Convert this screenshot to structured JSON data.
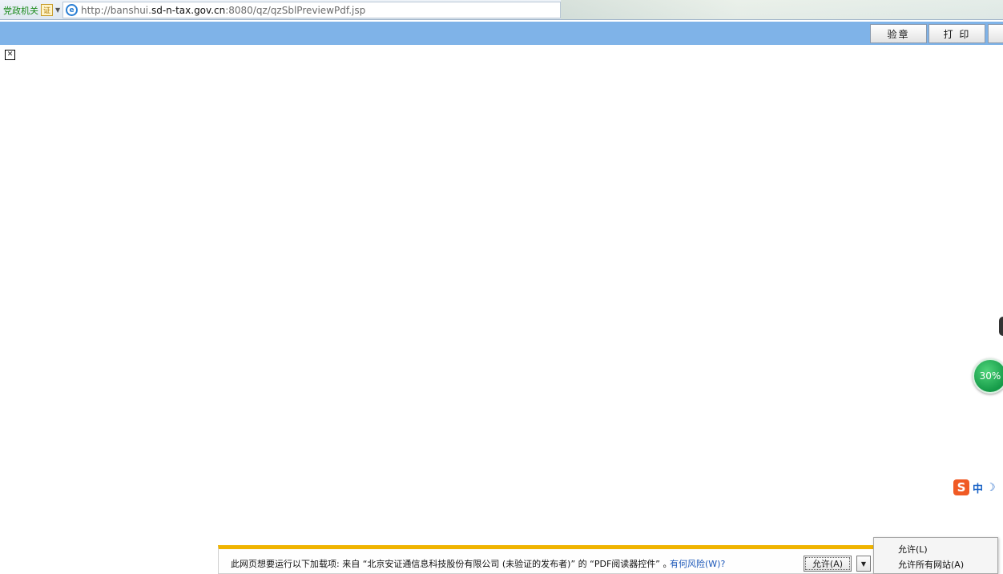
{
  "address_bar": {
    "zone_label": "党政机关",
    "cert_label": "证",
    "url_scheme": "http://banshui.",
    "url_host": "sd-n-tax.gov.cn",
    "url_path": ":8080/qz/qzSblPreviewPdf.jsp"
  },
  "toolbar": {
    "seal_label": "验章",
    "print_label": "打 印"
  },
  "content": {
    "close_glyph": "✕",
    "progress_label": "30%",
    "ime_logo": "S",
    "ime_lang": "中",
    "ime_moon": "☽"
  },
  "notification": {
    "message": "此网页想要运行以下加载项: 来自 “北京安证通信息科技股份有限公司 (未验证的发布者)” 的 “PDF阅读器控件” 。",
    "risk_link": "有何风险(W)?",
    "allow_label": "允许(A)",
    "dropdown_glyph": "▼"
  },
  "menu": {
    "items": [
      "允许(L)",
      "允许所有网站(A)"
    ]
  }
}
